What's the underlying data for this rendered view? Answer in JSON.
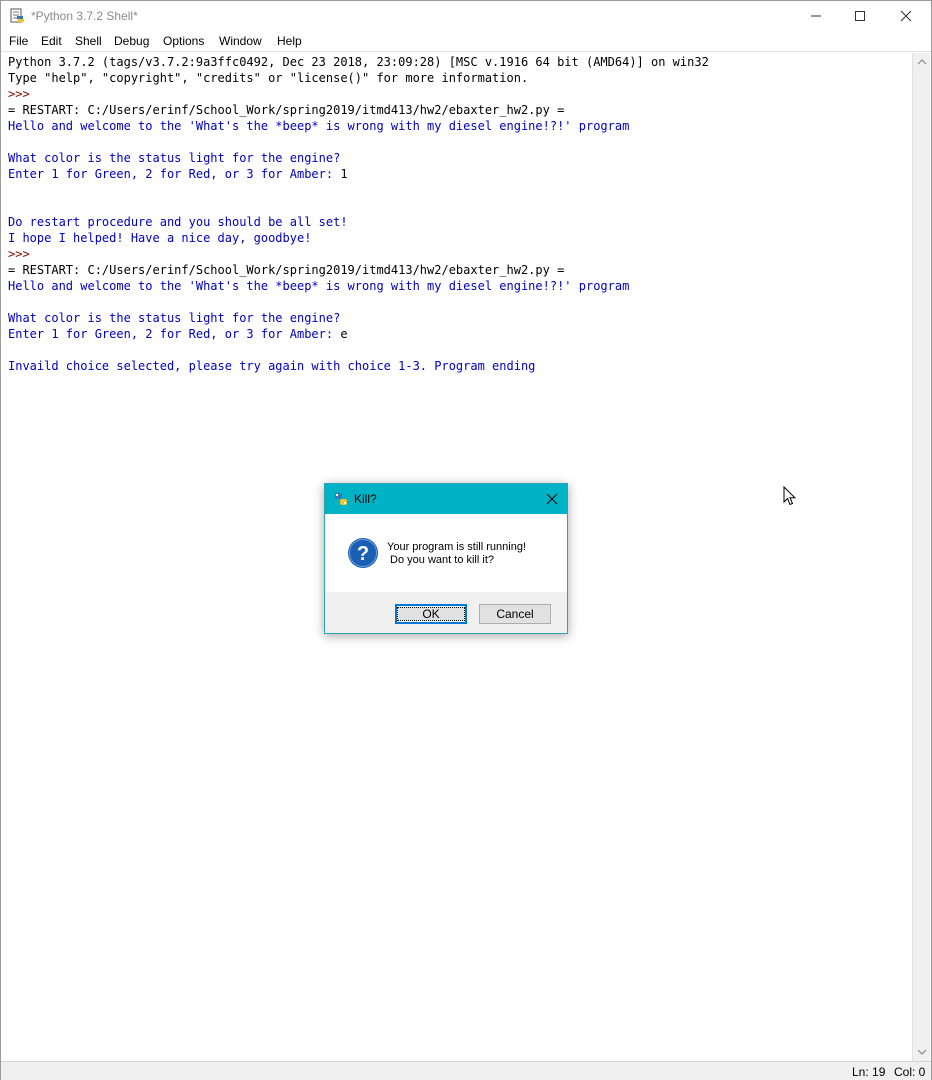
{
  "window": {
    "title": "*Python 3.7.2 Shell*",
    "icons": {
      "app": "python-idle-icon",
      "minimize": "minimize-icon",
      "maximize": "maximize-icon",
      "close": "close-icon"
    }
  },
  "menu": [
    "File",
    "Edit",
    "Shell",
    "Debug",
    "Options",
    "Window",
    "Help"
  ],
  "shell": {
    "lines": [
      {
        "text": "Python 3.7.2 (tags/v3.7.2:9a3ffc0492, Dec 23 2018, 23:09:28) [MSC v.1916 64 bit (AMD64)] on win32",
        "kind": "normal"
      },
      {
        "text": "Type \"help\", \"copyright\", \"credits\" or \"license()\" for more information.",
        "kind": "normal"
      },
      {
        "text": ">>> ",
        "kind": "prompt"
      },
      {
        "text": "= RESTART: C:/Users/erinf/School_Work/spring2019/itmd413/hw2/ebaxter_hw2.py =",
        "kind": "normal"
      },
      {
        "text": "Hello and welcome to the 'What's the *beep* is wrong with my diesel engine!?!' program",
        "kind": "out"
      },
      {
        "text": "",
        "kind": "out"
      },
      {
        "text": "What color is the status light for the engine?",
        "kind": "out"
      },
      {
        "text": "Enter 1 for Green, 2 for Red, or 3 for Amber: ",
        "kind": "out",
        "input": "1"
      },
      {
        "text": "",
        "kind": "out"
      },
      {
        "text": "",
        "kind": "out"
      },
      {
        "text": "Do restart procedure and you should be all set!",
        "kind": "out"
      },
      {
        "text": "I hope I helped! Have a nice day, goodbye!",
        "kind": "out"
      },
      {
        "text": ">>> ",
        "kind": "prompt"
      },
      {
        "text": "= RESTART: C:/Users/erinf/School_Work/spring2019/itmd413/hw2/ebaxter_hw2.py =",
        "kind": "normal"
      },
      {
        "text": "Hello and welcome to the 'What's the *beep* is wrong with my diesel engine!?!' program",
        "kind": "out"
      },
      {
        "text": "",
        "kind": "out"
      },
      {
        "text": "What color is the status light for the engine?",
        "kind": "out"
      },
      {
        "text": "Enter 1 for Green, 2 for Red, or 3 for Amber: ",
        "kind": "out",
        "input": "e"
      },
      {
        "text": "",
        "kind": "out"
      },
      {
        "text": "Invaild choice selected, please try again with choice 1-3. Program ending",
        "kind": "out"
      }
    ]
  },
  "status": {
    "line": "Ln: 19",
    "col": "Col: 0"
  },
  "dialog": {
    "title": "Kill?",
    "message_line1": "Your program is still running!",
    "message_line2": " Do you want to kill it?",
    "ok_label": "OK",
    "cancel_label": "Cancel",
    "icon": "question-icon",
    "title_bar_color": "#00b2c5"
  },
  "colors": {
    "output_text": "#0000c0",
    "prompt_text": "#8b0000",
    "normal_text": "#000000"
  }
}
